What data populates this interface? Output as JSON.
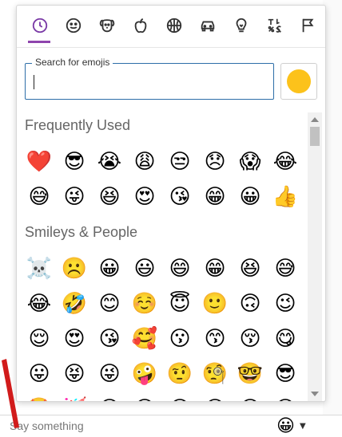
{
  "tabs": [
    {
      "name": "recent",
      "icon": "clock-icon",
      "active": true
    },
    {
      "name": "smileys",
      "icon": "smiley-icon"
    },
    {
      "name": "animals",
      "icon": "dog-icon"
    },
    {
      "name": "food",
      "icon": "apple-icon"
    },
    {
      "name": "activity",
      "icon": "basketball-icon"
    },
    {
      "name": "travel",
      "icon": "car-icon"
    },
    {
      "name": "objects",
      "icon": "lightbulb-icon"
    },
    {
      "name": "symbols",
      "icon": "symbols-icon"
    },
    {
      "name": "flags",
      "icon": "flag-icon"
    }
  ],
  "search": {
    "label": "Search for emojis",
    "value": ""
  },
  "tone": {
    "color": "#fcc21b"
  },
  "sections": {
    "frequent": {
      "title": "Frequently Used",
      "emojis": [
        "❤️",
        "😎",
        "😭",
        "😩",
        "😒",
        "😞",
        "😱",
        "😂",
        "😅",
        "😜",
        "😆",
        "😍",
        "😘",
        "😁",
        "😀",
        "👍"
      ]
    },
    "smileys": {
      "title": "Smileys & People",
      "emojis": [
        "☠️",
        "☹️",
        "😀",
        "😃",
        "😄",
        "😁",
        "😆",
        "😅",
        "😂",
        "🤣",
        "😊",
        "☺️",
        "😇",
        "🙂",
        "🙃",
        "😉",
        "😌",
        "😍",
        "😘",
        "🥰",
        "😗",
        "😙",
        "😚",
        "😋",
        "😛",
        "😝",
        "😜",
        "🤪",
        "🤨",
        "🧐",
        "🤓",
        "😎",
        "🤩",
        "🥳",
        "😏",
        "😒",
        "😞",
        "😔",
        "😟",
        "😕"
      ]
    }
  },
  "compose": {
    "placeholder": "Say something",
    "trigger_emoji": "😀"
  },
  "accent": "#8e44ad"
}
